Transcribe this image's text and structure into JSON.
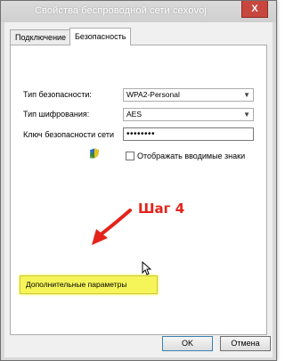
{
  "window": {
    "title": "Свойства беспроводной сети cexovoj",
    "close_label": "X"
  },
  "tabs": [
    {
      "label": "Подключение"
    },
    {
      "label": "Безопасность"
    }
  ],
  "form": {
    "security_type_label": "Тип безопасности:",
    "security_type_value": "WPA2-Personal",
    "encryption_type_label": "Тип шифрования:",
    "encryption_type_value": "AES",
    "key_label": "Ключ безопасности сети",
    "key_value": "••••••••",
    "show_chars_label": "Отображать вводимые знаки",
    "show_chars_checked": false
  },
  "annotation": {
    "step_label": "Шаг 4",
    "color": "#e4231b"
  },
  "advanced_button_label": "Дополнительные параметры",
  "footer": {
    "ok_label": "OK",
    "cancel_label": "Отмена"
  },
  "colors": {
    "highlight": "#f5f55a",
    "close": "#c7463e"
  }
}
